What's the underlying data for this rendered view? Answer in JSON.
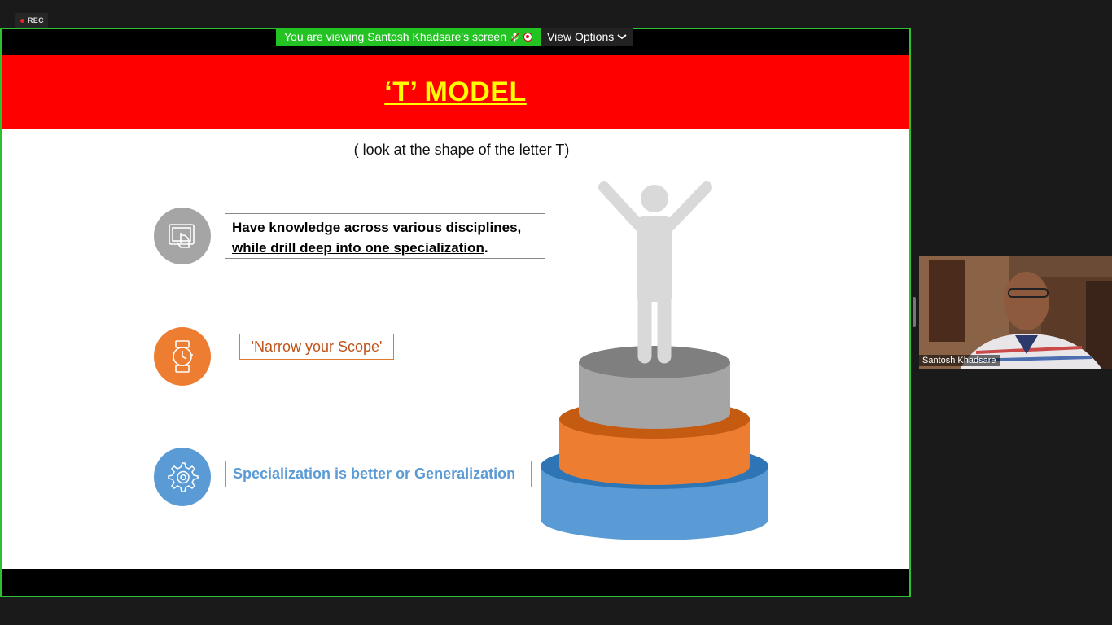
{
  "recording": {
    "label": "REC"
  },
  "share_banner": {
    "viewing_text": "You are viewing Santosh Khadsare's screen",
    "view_options_label": "View Options"
  },
  "slide": {
    "title": "‘T’ MODEL",
    "subtitle": "( look at the shape of the letter T)",
    "items": [
      {
        "icon": "touch-screen-icon",
        "line1": "Have knowledge across various disciplines,",
        "line2": "while drill deep into one specialization",
        "line2_suffix": "."
      },
      {
        "icon": "watch-icon",
        "text": "'Narrow your Scope'"
      },
      {
        "icon": "gear-icon",
        "text": "Specialization  is better or Generalization"
      }
    ]
  },
  "participant": {
    "name": "Santosh Khadsare"
  },
  "colors": {
    "header_red": "#ff0000",
    "title_yellow": "#ffff00",
    "share_green": "#23c323",
    "orange": "#ed7d31",
    "blue": "#5b9bd5",
    "grey": "#a5a5a5"
  }
}
